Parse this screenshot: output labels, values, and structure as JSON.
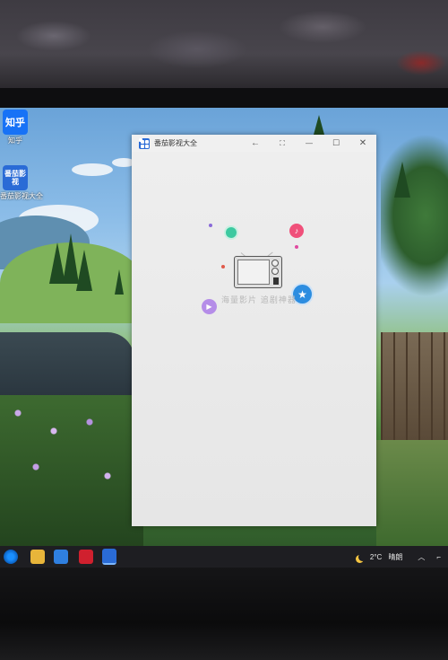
{
  "desktop": {
    "icons": [
      {
        "name": "知乎",
        "tile_text": "知乎"
      },
      {
        "name": "番茄影视大全",
        "tile_text": "番茄影视"
      }
    ]
  },
  "window": {
    "title": "番茄影视大全",
    "controls": {
      "back": "←",
      "fullscreen": "⛶",
      "minimize": "—",
      "maximize": "☐",
      "close": "✕"
    },
    "splash": {
      "slogan": "海量影片 追剧神器"
    },
    "accent_colors": {
      "green": "#3cc9a0",
      "pink": "#f0507a",
      "blue": "#2d8de0",
      "purple": "#b58de8"
    }
  },
  "taskbar": {
    "weather": {
      "temperature": "2°C",
      "condition": "晴朗"
    }
  }
}
